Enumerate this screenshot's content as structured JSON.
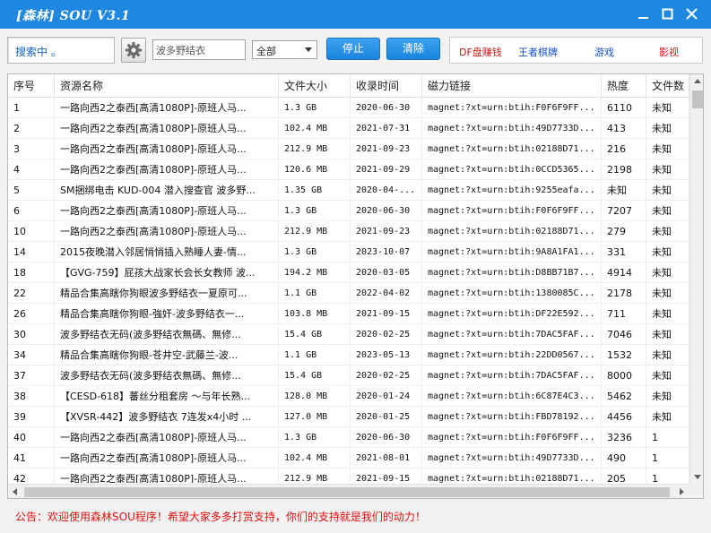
{
  "window": {
    "title": "[森林] SOU V3.1"
  },
  "toolbar": {
    "status_text": "搜索中 。",
    "search_value": "波多野结衣",
    "category_selected": "全部",
    "stop_label": "停止",
    "clear_label": "清除",
    "links": [
      "DF盘赚钱",
      "王者棋牌",
      "游戏",
      "影视"
    ]
  },
  "colors": {
    "titlebar": "#1e88e0",
    "button": "#2a92e8",
    "link_red": "#d01818",
    "link_blue": "#1450c8",
    "notice": "#e01010"
  },
  "table": {
    "columns": [
      "序号",
      "资源名称",
      "文件大小",
      "收录时间",
      "磁力链接",
      "热度",
      "文件数"
    ],
    "rows": [
      [
        "1",
        "一路向西2之泰西[高清1080P]-原班人马...",
        "1.3 GB",
        "2020-06-30",
        "magnet:?xt=urn:btih:F0F6F9FF...",
        "6110",
        "未知"
      ],
      [
        "2",
        "一路向西2之泰西[高清1080P]-原班人马...",
        "102.4 MB",
        "2021-07-31",
        "magnet:?xt=urn:btih:49D7733D...",
        "413",
        "未知"
      ],
      [
        "3",
        "一路向西2之泰西[高清1080P]-原班人马...",
        "212.9 MB",
        "2021-09-23",
        "magnet:?xt=urn:btih:02188D71...",
        "216",
        "未知"
      ],
      [
        "4",
        "一路向西2之泰西[高清1080P]-原班人马...",
        "120.6 MB",
        "2021-09-29",
        "magnet:?xt=urn:btih:0CCD5365...",
        "2198",
        "未知"
      ],
      [
        "5",
        "SM捆绑电击 KUD-004 潜入搜查官 波多野...",
        "1.35 GB",
        "2020-04-...",
        "magnet:?xt=urn:btih:9255eafa...",
        "未知",
        "未知"
      ],
      [
        "6",
        "一路向西2之泰西[高清1080P]-原班人马...",
        "1.3 GB",
        "2020-06-30",
        "magnet:?xt=urn:btih:F0F6F9FF...",
        "7207",
        "未知"
      ],
      [
        "10",
        "一路向西2之泰西[高清1080P]-原班人马...",
        "212.9 MB",
        "2021-09-23",
        "magnet:?xt=urn:btih:02188D71...",
        "279",
        "未知"
      ],
      [
        "14",
        "2015夜晚潜入邻居悄悄插入熟睡人妻-情...",
        "1.3 GB",
        "2023-10-07",
        "magnet:?xt=urn:btih:9A8A1FA1...",
        "331",
        "未知"
      ],
      [
        "18",
        "【GVG-759】屁孩大战家长会长女教师 波...",
        "194.2 MB",
        "2020-03-05",
        "magnet:?xt=urn:btih:D8BB71B7...",
        "4914",
        "未知"
      ],
      [
        "22",
        "精品合集高瞎你狗眼波多野结衣一夏原可...",
        "1.1 GB",
        "2022-04-02",
        "magnet:?xt=urn:btih:1380085C...",
        "2178",
        "未知"
      ],
      [
        "26",
        "精品合集高瞎你狗眼-強奸-波多野结衣一...",
        "103.8 MB",
        "2021-09-15",
        "magnet:?xt=urn:btih:DF22E592...",
        "711",
        "未知"
      ],
      [
        "30",
        "波多野结衣无码(波多野结衣無碼、無修...",
        "15.4 GB",
        "2020-02-25",
        "magnet:?xt=urn:btih:7DAC5FAF...",
        "7046",
        "未知"
      ],
      [
        "34",
        "精品合集高瞎你狗眼-苍井空-武藤兰-波...",
        "1.1 GB",
        "2023-05-13",
        "magnet:?xt=urn:btih:22DD0567...",
        "1532",
        "未知"
      ],
      [
        "37",
        "波多野结衣无码(波多野结衣無碼、無修...",
        "15.4 GB",
        "2020-02-25",
        "magnet:?xt=urn:btih:7DAC5FAF...",
        "8000",
        "未知"
      ],
      [
        "38",
        "【CESD-618】蕃丝分租套房 ～与年长熟...",
        "128.0 MB",
        "2020-01-24",
        "magnet:?xt=urn:btih:6C87E4C3...",
        "5462",
        "未知"
      ],
      [
        "39",
        "【XVSR-442】波多野结衣 7连发x4小时 ...",
        "127.0 MB",
        "2020-01-25",
        "magnet:?xt=urn:btih:FBD78192...",
        "4456",
        "未知"
      ],
      [
        "40",
        " 一路向西2之泰西[高清1080P]-原班人马...",
        "1.3 GB",
        "2020-06-30",
        "magnet:?xt=urn:btih:F0F6F9FF...",
        "3236",
        "1"
      ],
      [
        "41",
        " 一路向西2之泰西[高清1080P]-原班人马...",
        "102.4 MB",
        "2021-08-01",
        "magnet:?xt=urn:btih:49D7733D...",
        "490",
        "1"
      ],
      [
        "42",
        " 一路向西2之泰西[高清1080P]-原班人马...",
        "212.9 MB",
        "2021-09-15",
        "magnet:?xt=urn:btih:02188D71...",
        "205",
        "1"
      ]
    ]
  },
  "notice": "公告：欢迎使用森林SOU程序！希望大家多多打赏支持，你们的支持就是我们的动力！"
}
